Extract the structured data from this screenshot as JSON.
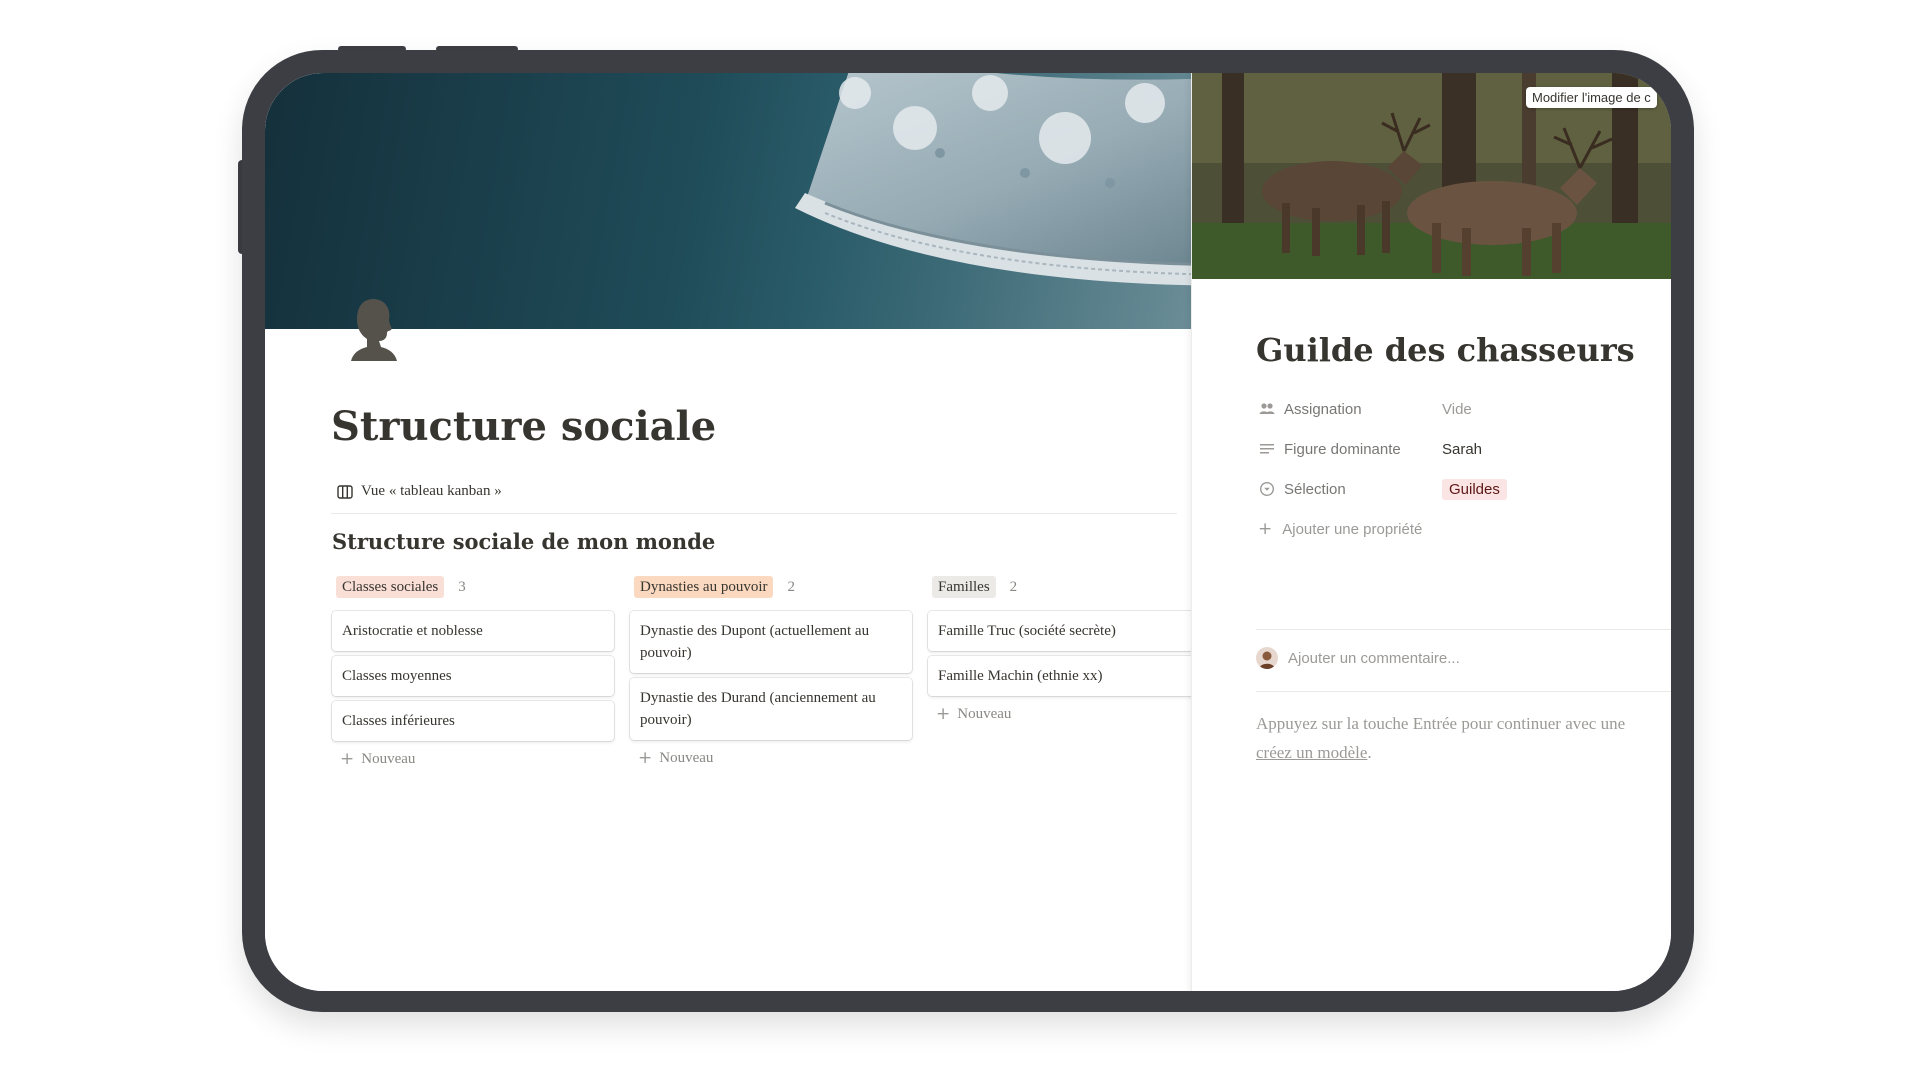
{
  "page": {
    "title": "Structure sociale",
    "view_label": "Vue « tableau kanban »",
    "database_title": "Structure sociale de mon monde"
  },
  "board": {
    "new_label": "Nouveau",
    "columns": [
      {
        "label": "Classes sociales",
        "count": "3",
        "tag_color": "#fadfd6",
        "cards": [
          "Aristocratie et noblesse",
          "Classes moyennes",
          "Classes inférieures"
        ]
      },
      {
        "label": "Dynasties au pouvoir",
        "count": "2",
        "tag_color": "#fbd9c1",
        "cards": [
          "Dynastie des Dupont (actuellement au pouvoir)",
          "Dynastie des Durand (anciennement au pouvoir)"
        ]
      },
      {
        "label": "Familles",
        "count": "2",
        "tag_color": "#ebeae7",
        "cards": [
          "Famille Truc (société secrète)",
          "Famille Machin (ethnie xx)"
        ]
      }
    ]
  },
  "panel": {
    "change_cover_label": "Modifier l'image de c",
    "title": "Guilde des chasseurs",
    "properties": [
      {
        "name": "Assignation",
        "value": "Vide",
        "icon": "people-icon"
      },
      {
        "name": "Figure dominante",
        "value": "Sarah",
        "icon": "text-lines-icon"
      },
      {
        "name": "Sélection",
        "value": "Guildes",
        "icon": "select-icon"
      }
    ],
    "add_property_label": "Ajouter une propriété",
    "comment_placeholder": "Ajouter un commentaire...",
    "hint_line1": "Appuyez sur la touche Entrée pour continuer avec une",
    "hint_link": "créez un modèle",
    "hint_end": "."
  },
  "colors": {
    "device_frame": "#3d3e44",
    "text": "#37352f",
    "muted": "#9b9a97",
    "selection_tag": "#fbe4e4"
  }
}
